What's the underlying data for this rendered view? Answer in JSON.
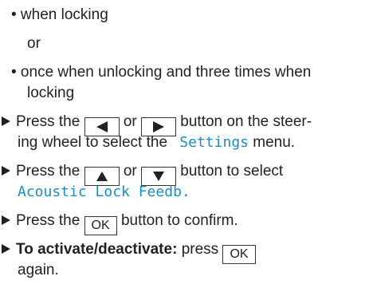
{
  "bullets": [
    {
      "text": "• when locking"
    },
    {
      "text": "• once when unlocking and three times when",
      "continuation": "locking"
    }
  ],
  "or_text": "or",
  "steps": {
    "step1": {
      "before": "Press the",
      "key_left": "left-arrow-key",
      "or": "or",
      "key_right": "right-arrow-key",
      "after": "button on the steer-",
      "line2_before": "ing wheel to select the",
      "menu_name": "Settings",
      "line2_after": "menu."
    },
    "step2": {
      "before": "Press the",
      "key_up": "up-arrow-key",
      "or": "or",
      "key_down": "down-arrow-key",
      "after": "button to select",
      "menu_item": "Acoustic Lock Feedb."
    },
    "step3": {
      "before": "Press the",
      "key_label": "OK",
      "after": "button to confirm."
    },
    "step4": {
      "bold": "To activate/deactivate:",
      "before": "press",
      "key_label": "OK",
      "continuation": "again."
    }
  },
  "colors": {
    "text": "#222222",
    "display_text": "#1f8cc0",
    "background": "#ffffff"
  }
}
